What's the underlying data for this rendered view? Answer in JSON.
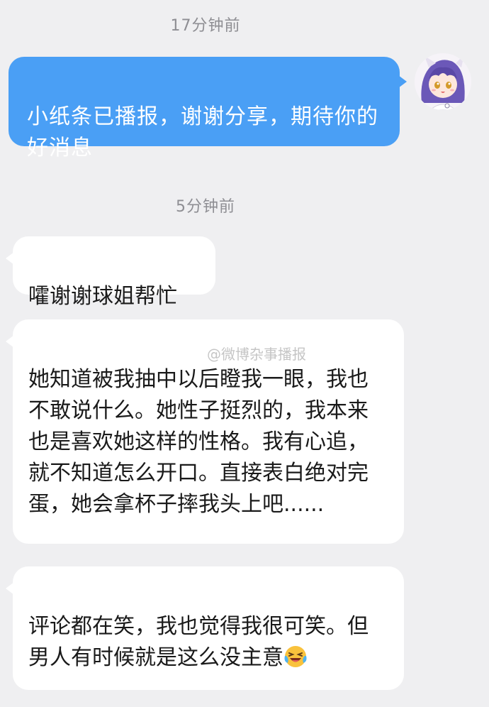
{
  "messages": [
    {
      "type": "timestamp",
      "text": "17分钟前"
    },
    {
      "type": "outgoing",
      "text": "小纸条已播报，谢谢分享，期待你的好消息"
    },
    {
      "type": "timestamp",
      "text": "5分钟前"
    },
    {
      "type": "incoming",
      "text": "嚯谢谢球姐帮忙"
    },
    {
      "type": "incoming",
      "text": "她知道被我抽中以后瞪我一眼，我也不敢说什么。她性子挺烈的，我本来也是喜欢她这样的性格。我有心追，就不知道怎么开口。直接表白绝对完蛋，她会拿杯子摔我头上吧......"
    },
    {
      "type": "incoming",
      "text": "评论都在笑，我也觉得我很可笑。但男人有时候就是这么没主意",
      "emoji": "laughing-crying-emoji"
    }
  ],
  "watermark": "@微博杂事播报",
  "colors": {
    "background": "#efeff1",
    "outgoing_bubble": "#4a9ff5",
    "incoming_bubble": "#ffffff"
  }
}
